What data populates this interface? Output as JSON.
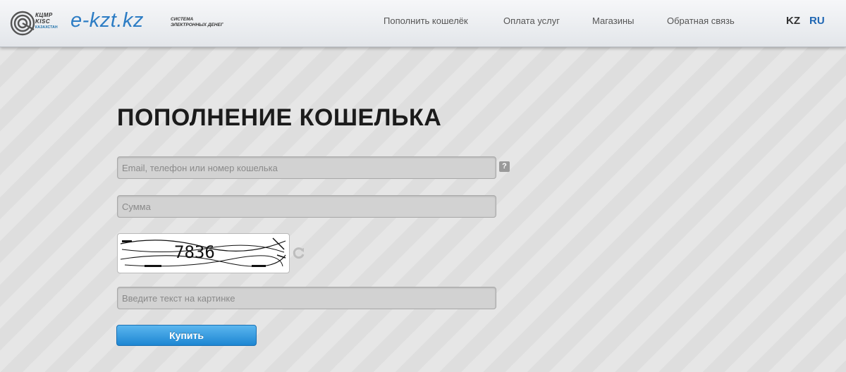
{
  "header": {
    "logo": {
      "mark": "kisc-swirl-logo",
      "line1": "КЦМР",
      "line2": "KISC",
      "line3": "КАЗАХСТАН"
    },
    "brand": "e-kzt.kz",
    "tagline": {
      "line1": "СИСТЕМА",
      "line2": "ЭЛЕКТРОННЫХ ДЕНЕГ"
    },
    "nav": [
      {
        "label": "Пополнить кошелёк"
      },
      {
        "label": "Оплата услуг"
      },
      {
        "label": "Магазины"
      },
      {
        "label": "Обратная связь"
      }
    ],
    "languages": [
      {
        "label": "KZ",
        "active": false
      },
      {
        "label": "RU",
        "active": true
      }
    ]
  },
  "form": {
    "title": "ПОПОЛНЕНИЕ КОШЕЛЬКА",
    "wallet_input": {
      "value": "",
      "placeholder": "Email, телефон или номер кошелька"
    },
    "help_icon": {
      "symbol": "?",
      "icon": "question-icon"
    },
    "amount_input": {
      "value": "",
      "placeholder": "Сумма"
    },
    "captcha": {
      "text": "7836",
      "refresh_icon": "refresh-icon"
    },
    "captcha_input": {
      "value": "",
      "placeholder": "Введите текст на картинке"
    },
    "submit_label": "Купить"
  },
  "colors": {
    "accent": "#2c7cc4",
    "button": "#1d86d2",
    "active_lang": "#1f66b3",
    "inactive_lang": "#333333"
  }
}
